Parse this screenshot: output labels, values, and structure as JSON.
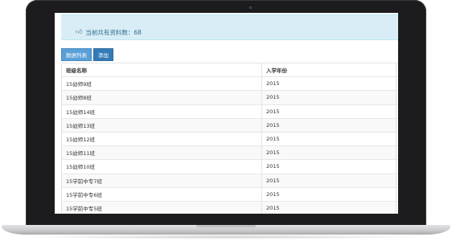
{
  "alert": {
    "icon": "thumbs-up-icon",
    "text": "当前共有资料数：68"
  },
  "buttons": {
    "list": "数据列表",
    "add": "添加"
  },
  "table": {
    "headers": [
      "班级名称",
      "入学年份",
      "⚙"
    ],
    "rows": [
      [
        "15幼师9班",
        "2015",
        "⊕"
      ],
      [
        "15幼师8班",
        "2015",
        "⊕"
      ],
      [
        "15幼师14班",
        "2015",
        "⊕"
      ],
      [
        "15幼师13班",
        "2015",
        "⊕"
      ],
      [
        "15幼师12班",
        "2015",
        "⊕"
      ],
      [
        "15幼师11班",
        "2015",
        "⊕"
      ],
      [
        "15幼师10班",
        "2015",
        "⊕"
      ],
      [
        "15学前中专7班",
        "2015",
        "⊕"
      ],
      [
        "15学前中专6班",
        "2015",
        "⊕"
      ],
      [
        "15学前中专5班",
        "2015",
        "⊕"
      ]
    ]
  },
  "colors": {
    "accent": "#337ab7",
    "alert_bg": "#d9edf7",
    "alert_text": "#31708f"
  }
}
